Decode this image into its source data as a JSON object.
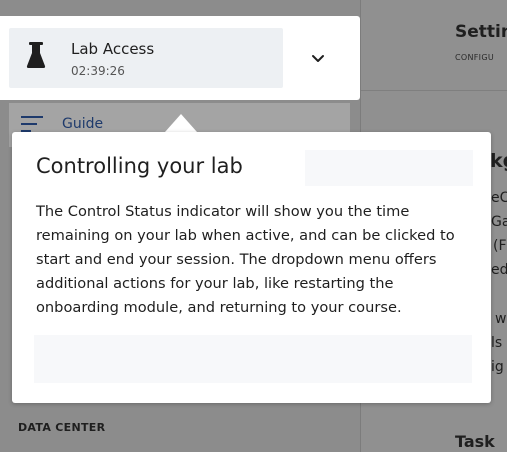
{
  "lab_control": {
    "title": "Lab Access",
    "timer": "02:39:26",
    "icon": "flask-icon",
    "dropdown_icon": "chevron-down-icon"
  },
  "guide": {
    "label": "Guide",
    "icon": "menu-lines-icon"
  },
  "sidebar": {
    "section_label": "DATA CENTER"
  },
  "settings_panel": {
    "title": "Settin",
    "subtitle": "CONFIGU",
    "partial_lines": [
      "kg",
      "eC",
      "Ga",
      "(F",
      "ed",
      "w",
      "ls",
      "ig"
    ],
    "task_title": "Task"
  },
  "tooltip": {
    "title": "Controlling your lab",
    "body": "The Control Status indicator will show you the time remaining on your lab when active, and can be clicked to start and end your session. The dropdown menu offers additional actions for your lab, like restarting the onboarding module, and returning to your course."
  },
  "colors": {
    "accent": "#1e3a6c",
    "overlay": "#8a8a8a",
    "card": "#ffffff",
    "card_inner": "#edf0f3"
  }
}
